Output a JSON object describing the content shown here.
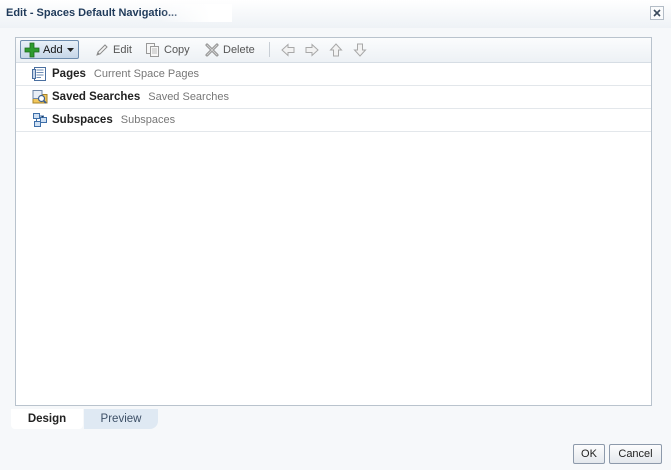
{
  "dialog": {
    "title": "Edit - Spaces Default Navigatio..."
  },
  "toolbar": {
    "add_label": "Add",
    "edit_label": "Edit",
    "copy_label": "Copy",
    "delete_label": "Delete"
  },
  "tree": {
    "items": [
      {
        "name": "Pages",
        "description": "Current Space Pages",
        "icon": "pages-icon"
      },
      {
        "name": "Saved Searches",
        "description": "Saved Searches",
        "icon": "saved-searches-icon"
      },
      {
        "name": "Subspaces",
        "description": "Subspaces",
        "icon": "subspaces-icon"
      }
    ]
  },
  "tabs": [
    {
      "label": "Design",
      "active": true
    },
    {
      "label": "Preview",
      "active": false
    }
  ],
  "footer": {
    "ok_label": "OK",
    "cancel_label": "Cancel"
  },
  "colors": {
    "accent": "#1f3a5a",
    "add_icon_green": "#2e9b2e",
    "tab_inactive": "#dfe9f3"
  }
}
